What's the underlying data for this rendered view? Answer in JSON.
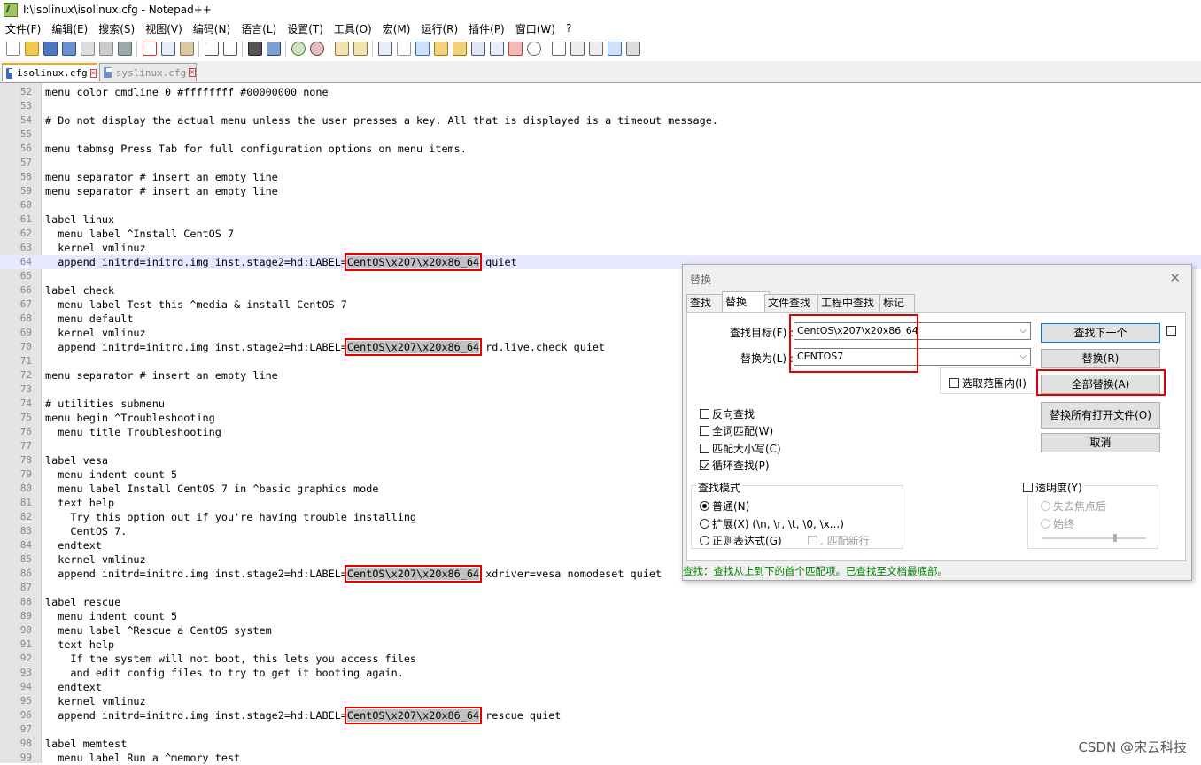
{
  "window": {
    "title": "I:\\isolinux\\isolinux.cfg - Notepad++"
  },
  "menubar": [
    "文件(F)",
    "编辑(E)",
    "搜索(S)",
    "视图(V)",
    "编码(N)",
    "语言(L)",
    "设置(T)",
    "工具(O)",
    "宏(M)",
    "运行(R)",
    "插件(P)",
    "窗口(W)",
    "?"
  ],
  "tabs": [
    {
      "label": "isolinux.cfg",
      "active": true
    },
    {
      "label": "syslinux.cfg",
      "active": false
    }
  ],
  "editor": {
    "lines": [
      {
        "n": "52",
        "t": "menu color cmdline 0 #ffffffff #00000000 none"
      },
      {
        "n": "53",
        "t": ""
      },
      {
        "n": "54",
        "t": "# Do not display the actual menu unless the user presses a key. All that is displayed is a timeout message."
      },
      {
        "n": "55",
        "t": ""
      },
      {
        "n": "56",
        "t": "menu tabmsg Press Tab for full configuration options on menu items."
      },
      {
        "n": "57",
        "t": ""
      },
      {
        "n": "58",
        "t": "menu separator # insert an empty line"
      },
      {
        "n": "59",
        "t": "menu separator # insert an empty line"
      },
      {
        "n": "60",
        "t": ""
      },
      {
        "n": "61",
        "t": "label linux"
      },
      {
        "n": "62",
        "t": "  menu label ^Install CentOS 7"
      },
      {
        "n": "63",
        "t": "  kernel vmlinuz"
      },
      {
        "n": "64",
        "t": "  append initrd=initrd.img inst.stage2=hd:LABEL=",
        "h": "CentOS\\x207\\x20x86_64",
        "a": " quiet",
        "current": true
      },
      {
        "n": "65",
        "t": ""
      },
      {
        "n": "66",
        "t": "label check"
      },
      {
        "n": "67",
        "t": "  menu label Test this ^media & install CentOS 7"
      },
      {
        "n": "68",
        "t": "  menu default"
      },
      {
        "n": "69",
        "t": "  kernel vmlinuz"
      },
      {
        "n": "70",
        "t": "  append initrd=initrd.img inst.stage2=hd:LABEL=",
        "h": "CentOS\\x207\\x20x86_64",
        "a": " rd.live.check quiet"
      },
      {
        "n": "71",
        "t": ""
      },
      {
        "n": "72",
        "t": "menu separator # insert an empty line"
      },
      {
        "n": "73",
        "t": ""
      },
      {
        "n": "74",
        "t": "# utilities submenu"
      },
      {
        "n": "75",
        "t": "menu begin ^Troubleshooting"
      },
      {
        "n": "76",
        "t": "  menu title Troubleshooting"
      },
      {
        "n": "77",
        "t": ""
      },
      {
        "n": "78",
        "t": "label vesa"
      },
      {
        "n": "79",
        "t": "  menu indent count 5"
      },
      {
        "n": "80",
        "t": "  menu label Install CentOS 7 in ^basic graphics mode"
      },
      {
        "n": "81",
        "t": "  text help"
      },
      {
        "n": "82",
        "t": "    Try this option out if you're having trouble installing"
      },
      {
        "n": "83",
        "t": "    CentOS 7."
      },
      {
        "n": "84",
        "t": "  endtext"
      },
      {
        "n": "85",
        "t": "  kernel vmlinuz"
      },
      {
        "n": "86",
        "t": "  append initrd=initrd.img inst.stage2=hd:LABEL=",
        "h": "CentOS\\x207\\x20x86_64",
        "a": " xdriver=vesa nomodeset quiet"
      },
      {
        "n": "87",
        "t": ""
      },
      {
        "n": "88",
        "t": "label rescue"
      },
      {
        "n": "89",
        "t": "  menu indent count 5"
      },
      {
        "n": "90",
        "t": "  menu label ^Rescue a CentOS system"
      },
      {
        "n": "91",
        "t": "  text help"
      },
      {
        "n": "92",
        "t": "    If the system will not boot, this lets you access files"
      },
      {
        "n": "93",
        "t": "    and edit config files to try to get it booting again."
      },
      {
        "n": "94",
        "t": "  endtext"
      },
      {
        "n": "95",
        "t": "  kernel vmlinuz"
      },
      {
        "n": "96",
        "t": "  append initrd=initrd.img inst.stage2=hd:LABEL=",
        "h": "CentOS\\x207\\x20x86_64",
        "a": " rescue quiet"
      },
      {
        "n": "97",
        "t": ""
      },
      {
        "n": "98",
        "t": "label memtest"
      },
      {
        "n": "99",
        "t": "  menu label Run a ^memory test"
      }
    ]
  },
  "dialog": {
    "title": "替换",
    "tabs": [
      "查找",
      "替换",
      "文件查找",
      "工程中查找",
      "标记"
    ],
    "find_label": "查找目标(F) :",
    "find_value": "CentOS\\x207\\x20x86_64",
    "replace_label": "替换为(L) :",
    "replace_value": "CENTOS7",
    "in_selection": "选取范围内(I)",
    "buttons": {
      "find_next": "查找下一个",
      "replace": "替换(R)",
      "replace_all": "全部替换(A)",
      "replace_all_open": "替换所有打开文件(O)",
      "cancel": "取消"
    },
    "options": [
      {
        "label": "反向查找",
        "checked": false
      },
      {
        "label": "全词匹配(W)",
        "checked": false
      },
      {
        "label": "匹配大小写(C)",
        "checked": false
      },
      {
        "label": "循环查找(P)",
        "checked": true
      }
    ],
    "search_mode": {
      "title": "查找模式",
      "normal": "普通(N)",
      "extended": "扩展(X) (\\n, \\r, \\t, \\0, \\x...)",
      "regex": "正则表达式(G)",
      "dot_newline": ". 匹配新行",
      "selected": "normal"
    },
    "transparency": {
      "label": "透明度(Y)",
      "on_lose_focus": "失去焦点后",
      "always": "始终",
      "level": 0.7
    },
    "status": "查找：查找从上到下的首个匹配项。已查找至文档最底部。"
  },
  "watermark": "CSDN @宋云科技",
  "colors": {
    "highlight_box": "#e00000",
    "status_text": "#008000",
    "current_line": "#e8e8ff"
  }
}
